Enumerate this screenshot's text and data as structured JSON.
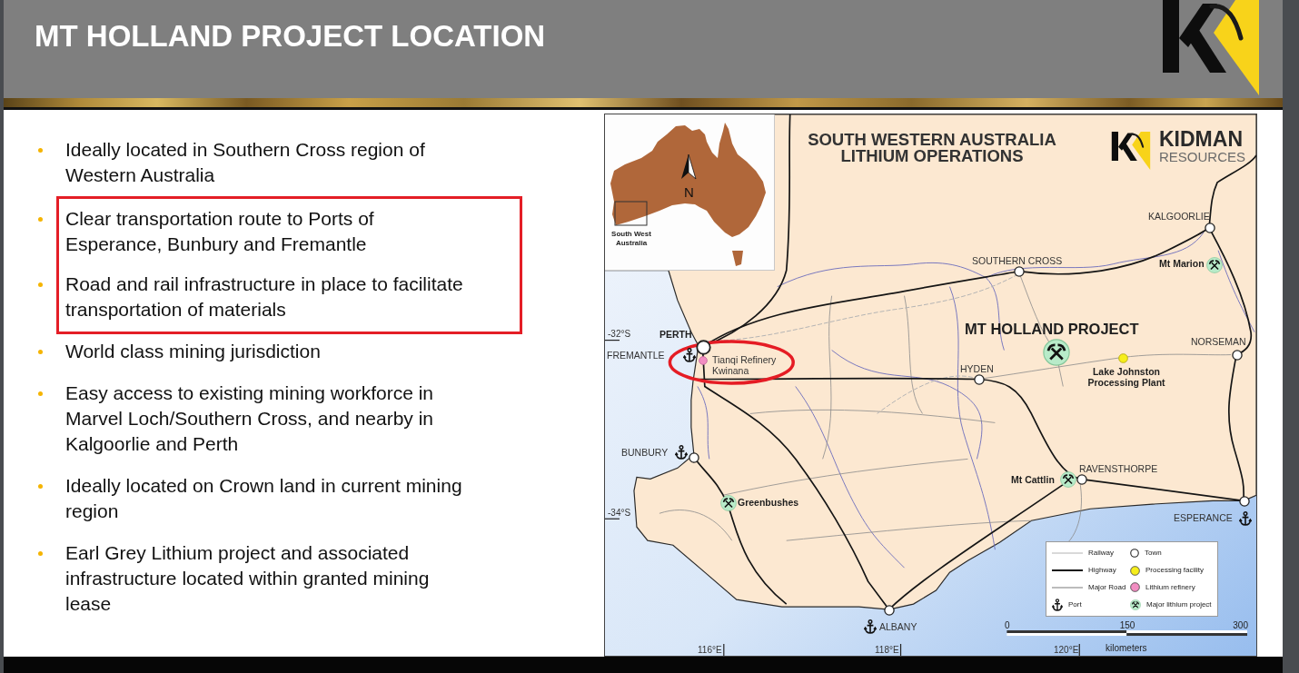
{
  "slide": {
    "title": "MT HOLLAND PROJECT LOCATION"
  },
  "bullets": [
    {
      "lines": [
        "Ideally located in Southern Cross region of",
        "Western Australia"
      ],
      "highlighted": false
    },
    {
      "lines": [
        "Clear transportation route to Ports of",
        "Esperance, Bunbury and Fremantle"
      ],
      "highlighted": true
    },
    {
      "lines": [
        "Road and rail infrastructure in place to facilitate",
        "transportation of materials"
      ],
      "highlighted": true
    },
    {
      "lines": [
        "World class mining jurisdiction"
      ],
      "highlighted": false
    },
    {
      "lines": [
        "Easy access to existing mining workforce in",
        "Marvel Loch/Southern Cross, and nearby in",
        "Kalgoorlie and Perth"
      ],
      "highlighted": false
    },
    {
      "lines": [
        "Ideally located on Crown land in current mining",
        "region"
      ],
      "highlighted": false
    },
    {
      "lines": [
        "Earl Grey Lithium project and associated",
        "infrastructure located within granted mining",
        "lease"
      ],
      "highlighted": false
    }
  ],
  "map": {
    "title": "SOUTH WESTERN AUSTRALIA LITHIUM OPERATIONS",
    "logo": {
      "name": "KIDMAN",
      "tagline": "RESOURCES"
    },
    "inset": {
      "north_label": "N",
      "region_label": "South West Australia"
    },
    "places": [
      {
        "name": "KALGOORLIE",
        "kind": "town",
        "circled": false
      },
      {
        "name": "SOUTHERN CROSS",
        "kind": "town",
        "circled": false
      },
      {
        "name": "Mt Marion",
        "kind": "project",
        "circled": false
      },
      {
        "name": "PERTH",
        "kind": "city",
        "circled": false
      },
      {
        "name": "MT HOLLAND PROJECT",
        "kind": "featured-project",
        "circled": false
      },
      {
        "name": "NORSEMAN",
        "kind": "town",
        "circled": false
      },
      {
        "name": "FREMANTLE",
        "kind": "port",
        "circled": false
      },
      {
        "name": "Tianqi Refinery Kwinana",
        "kind": "refinery",
        "circled": true
      },
      {
        "name": "HYDEN",
        "kind": "town",
        "circled": false
      },
      {
        "name": "Lake Johnston Processing Plant",
        "kind": "processing",
        "circled": false
      },
      {
        "name": "BUNBURY",
        "kind": "port-town",
        "circled": false
      },
      {
        "name": "RAVENSTHORPE",
        "kind": "town",
        "circled": false
      },
      {
        "name": "Mt Cattlin",
        "kind": "project",
        "circled": false
      },
      {
        "name": "Greenbushes",
        "kind": "project",
        "circled": false
      },
      {
        "name": "ESPERANCE",
        "kind": "port-town",
        "circled": false
      },
      {
        "name": "ALBANY",
        "kind": "port-town",
        "circled": false
      }
    ],
    "latitudes": [
      "-32°S",
      "-34°S"
    ],
    "longitudes": [
      "116°E",
      "118°E",
      "120°E"
    ],
    "legend": [
      {
        "label": "Railway",
        "kind": "railway"
      },
      {
        "label": "Highway",
        "kind": "highway"
      },
      {
        "label": "Major Road",
        "kind": "road"
      },
      {
        "label": "Port",
        "kind": "port"
      },
      {
        "label": "Town",
        "kind": "town"
      },
      {
        "label": "Processing facility",
        "kind": "processing"
      },
      {
        "label": "Lithium refinery",
        "kind": "refinery"
      },
      {
        "label": "Major lithium project",
        "kind": "project"
      }
    ],
    "scale": {
      "ticks": [
        "0",
        "150",
        "300"
      ],
      "unit": "kilometers"
    }
  }
}
